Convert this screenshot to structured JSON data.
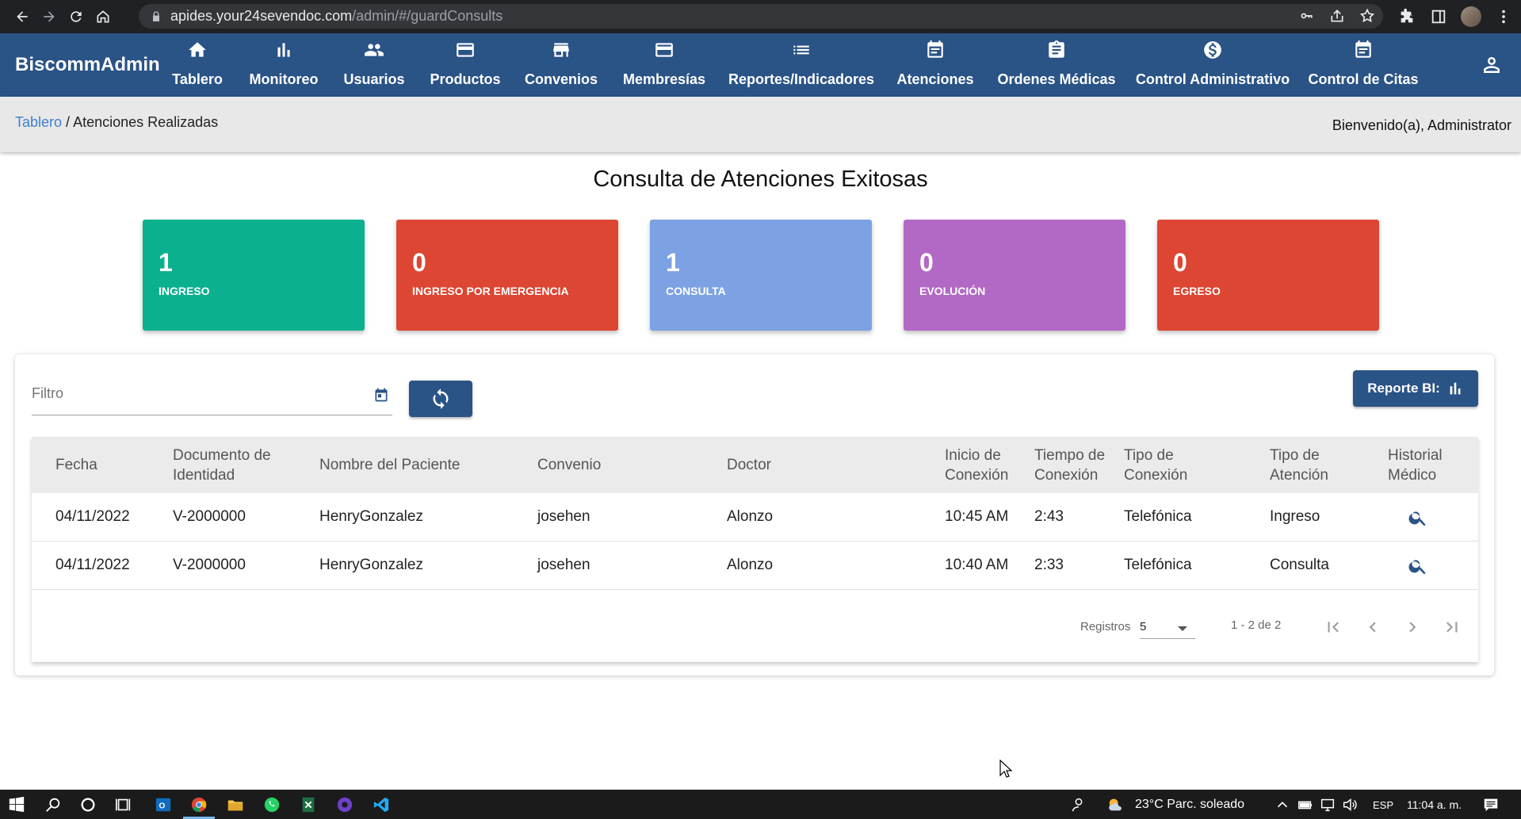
{
  "browser": {
    "url_host": "apides.your24sevendoc.com",
    "url_path": "/admin/#/guardConsults"
  },
  "app": {
    "brand": "BiscommAdmin",
    "nav": [
      {
        "label": "Tablero",
        "icon": "home-icon"
      },
      {
        "label": "Monitoreo",
        "icon": "bar-chart-icon"
      },
      {
        "label": "Usuarios",
        "icon": "people-icon"
      },
      {
        "label": "Productos",
        "icon": "credit-card-icon"
      },
      {
        "label": "Convenios",
        "icon": "store-icon"
      },
      {
        "label": "Membresías",
        "icon": "credit-card-icon"
      },
      {
        "label": "Reportes/Indicadores",
        "icon": "list-icon"
      },
      {
        "label": "Atenciones",
        "icon": "event-note-icon"
      },
      {
        "label": "Ordenes Médicas",
        "icon": "assignment-icon"
      },
      {
        "label": "Control Administrativo",
        "icon": "dollar-icon"
      },
      {
        "label": "Control de Citas",
        "icon": "event-note-icon"
      }
    ]
  },
  "breadcrumb": {
    "root": "Tablero",
    "separator": " / ",
    "current": "Atenciones Realizadas"
  },
  "welcome": "Bienvenido(a), Administrator",
  "page_title": "Consulta de Atenciones Exitosas",
  "cards": [
    {
      "value": "1",
      "label": "INGRESO",
      "color": "#0bb08f"
    },
    {
      "value": "0",
      "label": "INGRESO POR EMERGENCIA",
      "color": "#dc4632"
    },
    {
      "value": "1",
      "label": "CONSULTA",
      "color": "#7ca2e4"
    },
    {
      "value": "0",
      "label": "EVOLUCIÓN",
      "color": "#b269c5"
    },
    {
      "value": "0",
      "label": "EGRESO",
      "color": "#dc4632"
    }
  ],
  "filter": {
    "placeholder": "Filtro",
    "value": ""
  },
  "bi_button": "Reporte BI:",
  "table": {
    "headers": [
      [
        "Fecha"
      ],
      [
        "Documento de",
        "Identidad"
      ],
      [
        "Nombre del Paciente"
      ],
      [
        "Convenio"
      ],
      [
        "Doctor"
      ],
      [
        "Inicio de",
        "Conexión"
      ],
      [
        "Tiempo de",
        "Conexión"
      ],
      [
        "Tipo de",
        "Conexión"
      ],
      [
        "Tipo de",
        "Atención"
      ],
      [
        "Historial",
        "Médico"
      ]
    ],
    "rows": [
      [
        "04/11/2022",
        "V-2000000",
        "HenryGonzalez",
        "josehen",
        "Alonzo",
        "10:45 AM",
        "2:43",
        "Telefónica",
        "Ingreso"
      ],
      [
        "04/11/2022",
        "V-2000000",
        "HenryGonzalez",
        "josehen",
        "Alonzo",
        "10:40 AM",
        "2:33",
        "Telefónica",
        "Consulta"
      ]
    ]
  },
  "paginator": {
    "label": "Registros",
    "page_size": "5",
    "range": "1 - 2 de 2"
  },
  "taskbar": {
    "weather": "23°C  Parc. soleado",
    "lang": "ESP",
    "time": "11:04 a. m."
  },
  "colors": {
    "primary": "#2a5386",
    "chrome": "#202124",
    "link": "#3f7fce"
  }
}
